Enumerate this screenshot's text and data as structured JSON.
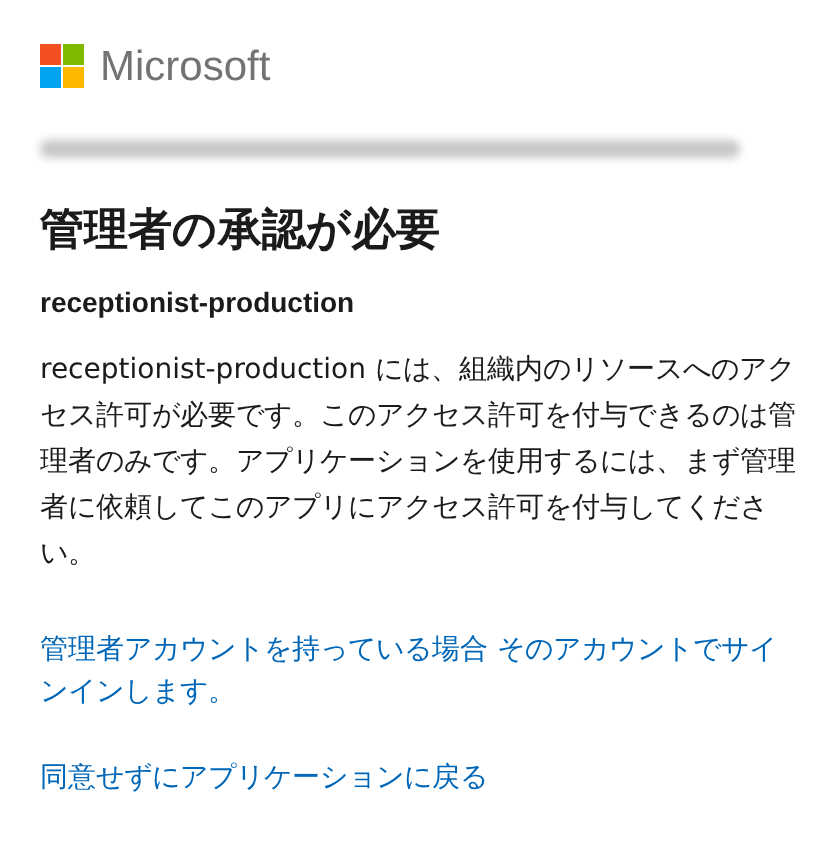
{
  "brand": "Microsoft",
  "title": "管理者の承認が必要",
  "app_name": "receptionist-production",
  "message": "receptionist-production には、組織内のリソースへのアクセス許可が必要です。このアクセス許可を付与できるのは管理者のみです。アプリケーションを使用するには、まず管理者に依頼してこのアプリにアクセス許可を付与してください。",
  "links": [
    "管理者アカウントを持っている場合 そのアカウントでサインインします。",
    "同意せずにアプリケーションに戻る"
  ]
}
